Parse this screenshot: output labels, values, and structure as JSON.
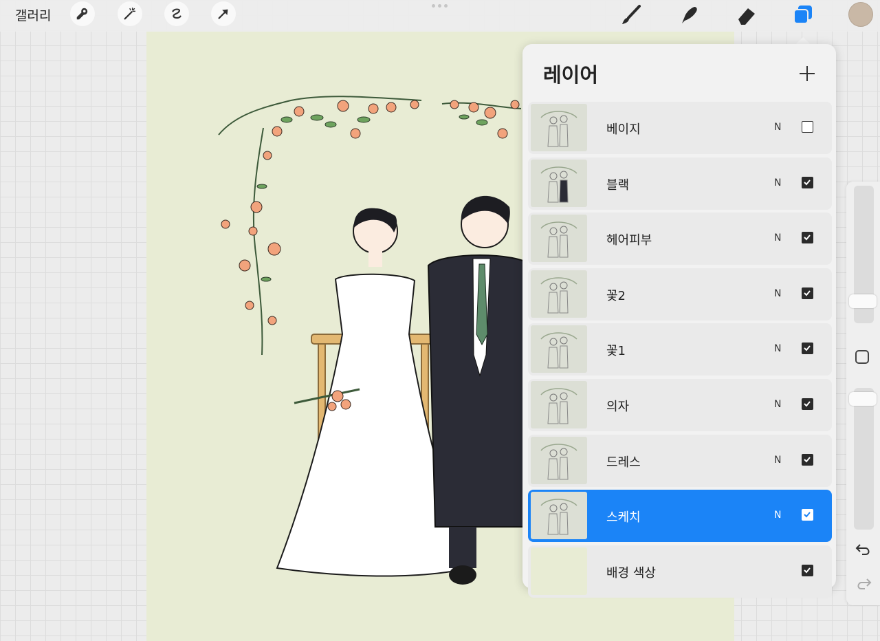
{
  "topbar": {
    "gallery_label": "갤러리",
    "left_tools": [
      "wrench-icon",
      "magic-wand-icon",
      "selection-icon",
      "transform-arrow-icon"
    ],
    "right_tools": [
      "brush-icon",
      "smudge-icon",
      "eraser-icon",
      "layers-icon"
    ],
    "active_color": "#c9b8a6",
    "accent": "#1b84f7"
  },
  "layers_panel": {
    "title": "레이어",
    "add_icon": "plus-icon",
    "layers": [
      {
        "name": "베이지",
        "blend": "N",
        "visible": false,
        "selected": false
      },
      {
        "name": "블랙",
        "blend": "N",
        "visible": true,
        "selected": false
      },
      {
        "name": "헤어피부",
        "blend": "N",
        "visible": true,
        "selected": false
      },
      {
        "name": "꽃2",
        "blend": "N",
        "visible": true,
        "selected": false
      },
      {
        "name": "꽃1",
        "blend": "N",
        "visible": true,
        "selected": false
      },
      {
        "name": "의자",
        "blend": "N",
        "visible": true,
        "selected": false
      },
      {
        "name": "드레스",
        "blend": "N",
        "visible": true,
        "selected": false
      },
      {
        "name": "스케치",
        "blend": "N",
        "visible": true,
        "selected": true
      },
      {
        "name": "배경 색상",
        "blend": "",
        "visible": true,
        "selected": false
      }
    ]
  },
  "sidebar": {
    "undo_icon": "undo-icon",
    "redo_icon": "redo-icon"
  },
  "canvas": {
    "background_color": "#e8ecd4"
  }
}
